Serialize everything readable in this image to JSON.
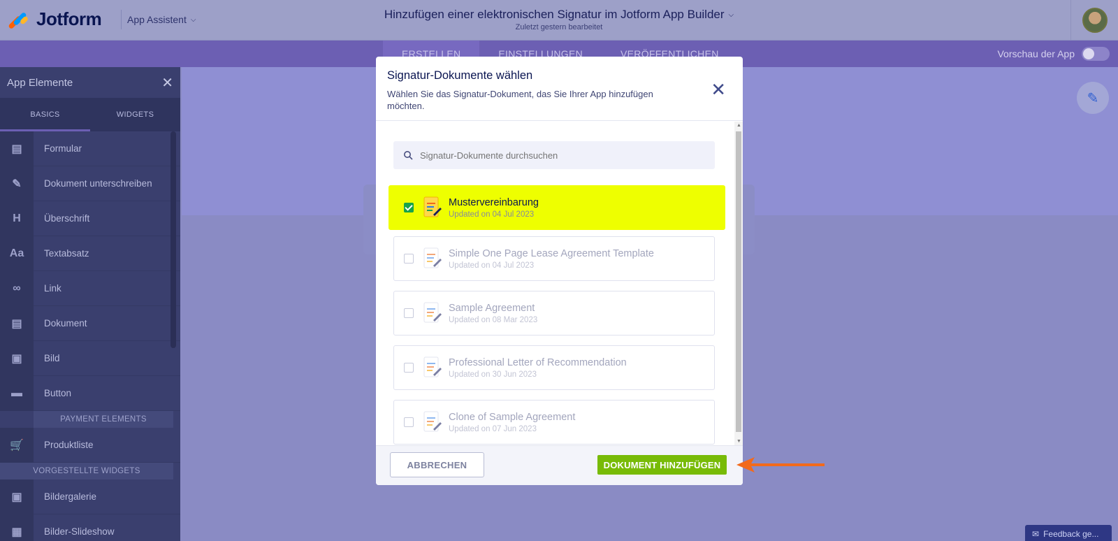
{
  "header": {
    "logo_text": "Jotform",
    "app_assistant": "App Assistent",
    "title": "Hinzufügen einer elektronischen Signatur im Jotform App Builder",
    "subtitle": "Zuletzt gestern bearbeitet"
  },
  "nav": {
    "tabs": [
      {
        "label": "ERSTELLEN",
        "active": true
      },
      {
        "label": "EINSTELLUNGEN",
        "active": false
      },
      {
        "label": "VERÖFFENTLICHEN",
        "active": false
      }
    ],
    "preview_label": "Vorschau der App"
  },
  "sidebar": {
    "title": "App Elemente",
    "tabs": [
      "BASICS",
      "WIDGETS"
    ],
    "items": [
      {
        "label": "Formular",
        "icon": "form-icon"
      },
      {
        "label": "Dokument unterschreiben",
        "icon": "sign-document-icon"
      },
      {
        "label": "Überschrift",
        "icon": "heading-icon"
      },
      {
        "label": "Textabsatz",
        "icon": "paragraph-icon"
      },
      {
        "label": "Link",
        "icon": "link-icon"
      },
      {
        "label": "Dokument",
        "icon": "document-icon"
      },
      {
        "label": "Bild",
        "icon": "image-icon"
      },
      {
        "label": "Button",
        "icon": "button-icon"
      }
    ],
    "payment_section": "PAYMENT ELEMENTS",
    "payment_items": [
      {
        "label": "Produktliste",
        "icon": "cart-icon"
      }
    ],
    "widgets_section": "VORGESTELLTE WIDGETS",
    "widget_items": [
      {
        "label": "Bildergalerie",
        "icon": "gallery-icon"
      },
      {
        "label": "Bilder-Slideshow",
        "icon": "slideshow-icon"
      }
    ]
  },
  "modal": {
    "title": "Signatur-Dokumente wählen",
    "description": "Wählen Sie das Signatur-Dokument, das Sie Ihrer App hinzufügen möchten.",
    "search_placeholder": "Signatur-Dokumente durchsuchen",
    "documents": [
      {
        "name": "Mustervereinbarung",
        "date": "Updated on 04 Jul 2023",
        "checked": true
      },
      {
        "name": "Simple One Page Lease Agreement Template",
        "date": "Updated on 04 Jul 2023",
        "checked": false
      },
      {
        "name": "Sample Agreement",
        "date": "Updated on 08 Mar 2023",
        "checked": false
      },
      {
        "name": "Professional Letter of Recommendation",
        "date": "Updated on 30 Jun 2023",
        "checked": false
      },
      {
        "name": "Clone of Sample Agreement",
        "date": "Updated on 07 Jun 2023",
        "checked": false
      }
    ],
    "cancel_label": "ABBRECHEN",
    "add_label": "DOKUMENT HINZUFÜGEN"
  },
  "feedback_label": "Feedback ge...",
  "colors": {
    "highlight": "#eeff00",
    "add_button": "#78bb07",
    "arrow": "#f26a1b",
    "nav_purple": "#6c5fb3"
  }
}
